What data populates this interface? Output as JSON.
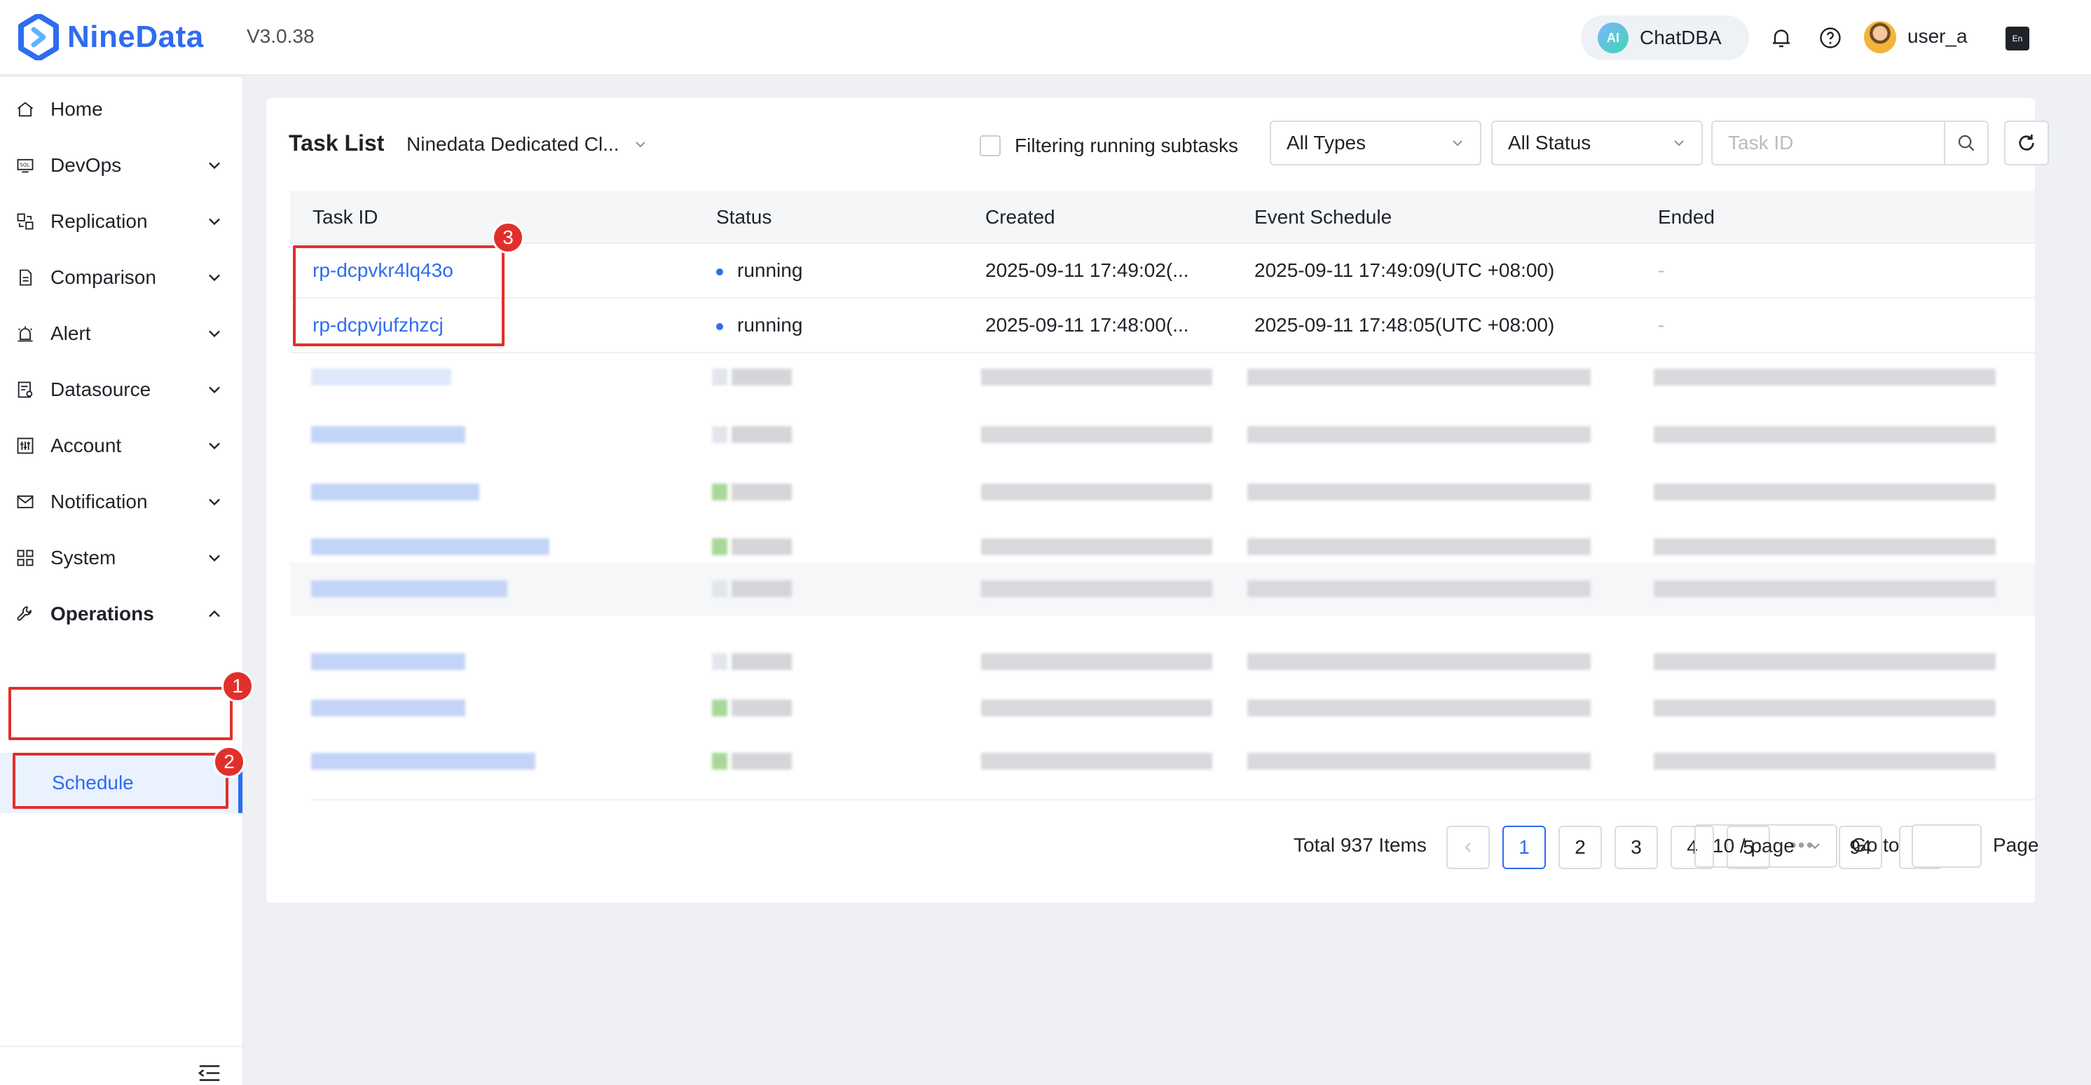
{
  "header": {
    "brand": "NineData",
    "version": "V3.0.38",
    "chatdba_label": "ChatDBA",
    "ai_badge": "AI",
    "username": "user_a",
    "lang_icon_text": "En"
  },
  "sidebar": {
    "items": [
      {
        "label": "Home",
        "icon": "home-icon"
      },
      {
        "label": "DevOps",
        "icon": "sql-icon"
      },
      {
        "label": "Replication",
        "icon": "replication-icon"
      },
      {
        "label": "Comparison",
        "icon": "comparison-icon"
      },
      {
        "label": "Alert",
        "icon": "alarm-icon"
      },
      {
        "label": "Datasource",
        "icon": "datasource-icon"
      },
      {
        "label": "Account",
        "icon": "account-icon"
      },
      {
        "label": "Notification",
        "icon": "mail-icon"
      },
      {
        "label": "System",
        "icon": "grid-icon"
      },
      {
        "label": "Operations",
        "icon": "wrench-icon"
      }
    ],
    "active_submenu": "Schedule"
  },
  "markers": [
    "1",
    "2",
    "3"
  ],
  "task_list": {
    "title": "Task List",
    "cluster": "Ninedata Dedicated Cl...",
    "filter_running_label": "Filtering running subtasks",
    "type_select": "All Types",
    "status_select": "All Status",
    "task_id_placeholder": "Task ID",
    "columns": [
      "Task ID",
      "Status",
      "Created",
      "Event Schedule",
      "Ended"
    ],
    "rows": [
      {
        "task_id": "rp-dcpvkr4lq43o",
        "status": "running",
        "created": "2025-09-11 17:49:02(...",
        "event_schedule": "2025-09-11 17:49:09(UTC +08:00)",
        "ended": "-"
      },
      {
        "task_id": "rp-dcpvjufzhzcj",
        "status": "running",
        "created": "2025-09-11 17:48:00(...",
        "event_schedule": "2025-09-11 17:48:05(UTC +08:00)",
        "ended": "-"
      }
    ]
  },
  "pagination": {
    "total": "Total 937 Items",
    "pages": [
      "1",
      "2",
      "3",
      "4",
      "5"
    ],
    "ellipsis": "•••",
    "last_page": "94",
    "current_page": "1",
    "page_size": "10 / page",
    "goto_label": "Go to",
    "page_label": "Page"
  },
  "colors": {
    "accent": "#2e6cf0",
    "highlight": "#e0302b",
    "status_running": "#2e6cf0"
  }
}
